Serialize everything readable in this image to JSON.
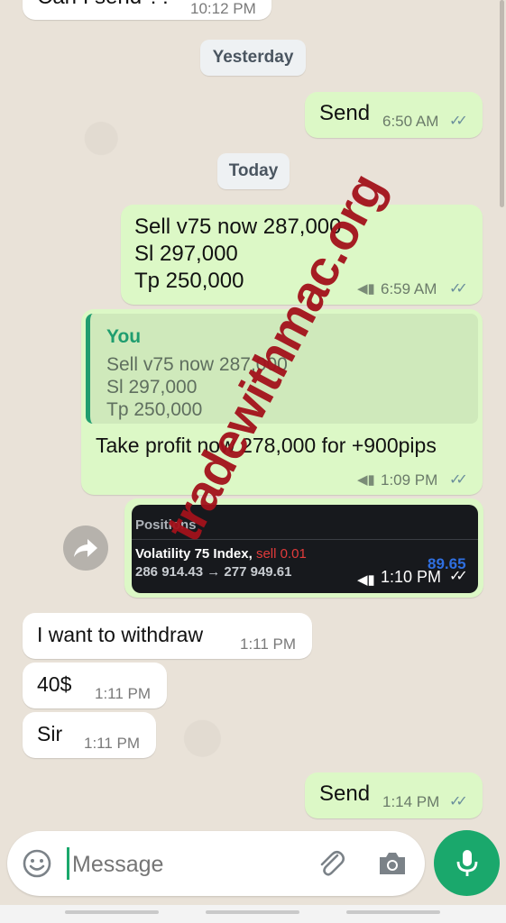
{
  "top_partial": {
    "text": "Can I send ??",
    "time": "10:12 PM"
  },
  "date_chips": {
    "yesterday": "Yesterday",
    "today": "Today"
  },
  "messages": {
    "send1": {
      "text": "Send",
      "time": "6:50 AM"
    },
    "signal": {
      "line1": "Sell v75 now 287,000",
      "line2": "Sl 297,000",
      "line3": "Tp 250,000",
      "time": "6:59 AM"
    },
    "reply": {
      "quote_author": "You",
      "quote_line1": "Sell v75 now 287,000",
      "quote_line2": "Sl 297,000",
      "quote_line3": "Tp 250,000",
      "text": "Take profit now 278,000 for +900pips",
      "time": "1:09 PM"
    },
    "image": {
      "header": "Positions",
      "symbol": "Volatility 75 Index,",
      "side": "sell 0.01",
      "prices": "286 914.43 → 277 949.61",
      "profit": "89.65",
      "time": "1:10 PM"
    },
    "in1": {
      "text": "I want to withdraw",
      "time": "1:11 PM"
    },
    "in2": {
      "text": "40$",
      "time": "1:11 PM"
    },
    "in3": {
      "text": "Sir",
      "time": "1:11 PM"
    },
    "send2": {
      "text": "Send",
      "time": "1:14 PM"
    }
  },
  "watermark": "tradewithmac.org",
  "input": {
    "placeholder": "Message"
  },
  "icons": {
    "emoji": "emoji-icon",
    "attach": "paperclip-icon",
    "camera": "camera-icon",
    "mic": "microphone-icon",
    "forward": "forward-icon",
    "ticks": "double-check-icon",
    "broadcast": "megaphone-icon"
  },
  "colors": {
    "outgoing": "#dcf8c6",
    "incoming": "#ffffff",
    "accent": "#1aa86c",
    "watermark": "#a3121b"
  }
}
